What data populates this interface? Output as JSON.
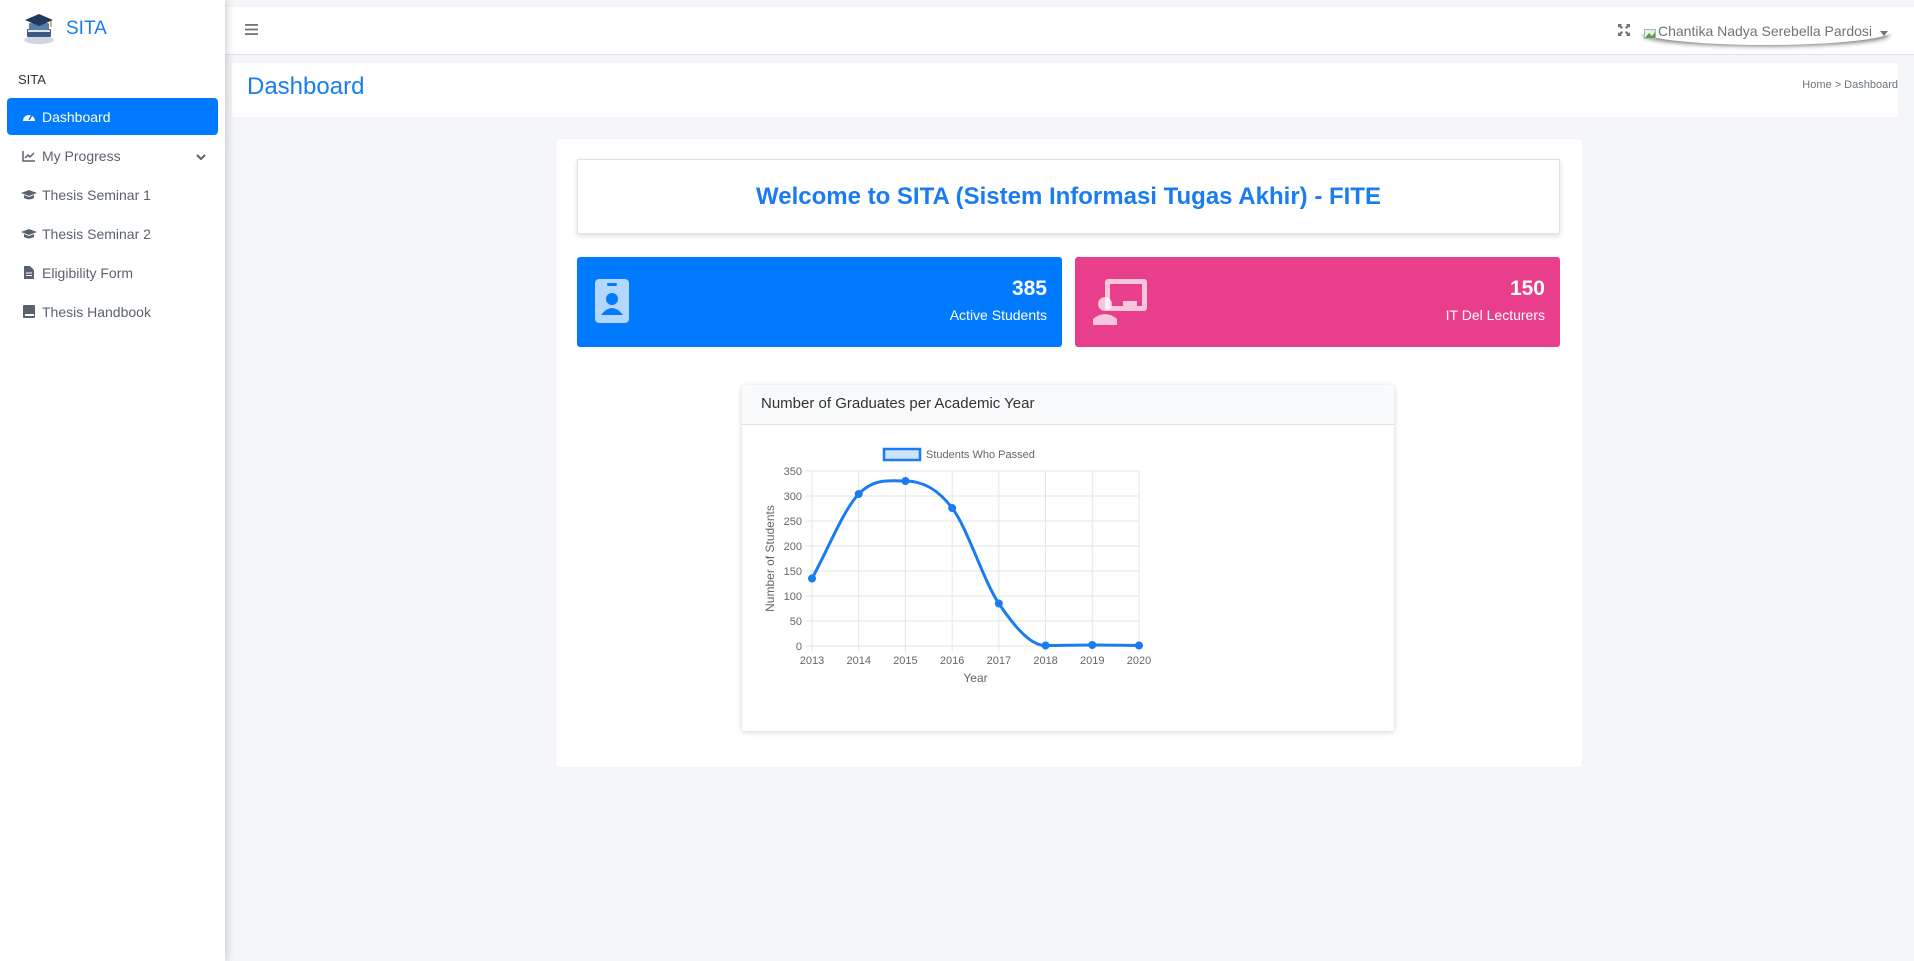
{
  "brand": {
    "name": "SITA"
  },
  "sidebar": {
    "section": "SITA",
    "items": [
      {
        "label": "Dashboard",
        "icon": "tachometer-icon",
        "active": true
      },
      {
        "label": "My Progress",
        "icon": "chart-line-icon",
        "has_children": true
      },
      {
        "label": "Thesis Seminar 1",
        "icon": "graduation-cap-icon"
      },
      {
        "label": "Thesis Seminar 2",
        "icon": "graduation-cap-icon"
      },
      {
        "label": "Eligibility Form",
        "icon": "file-icon"
      },
      {
        "label": "Thesis Handbook",
        "icon": "book-icon"
      }
    ]
  },
  "topbar": {
    "user_name": "Chantika Nadya Serebella Pardosi"
  },
  "header": {
    "title": "Dashboard",
    "breadcrumb": "Home > Dashboard"
  },
  "welcome": {
    "text": "Welcome to SITA (Sistem Informasi Tugas Akhir) - FITE"
  },
  "stats": [
    {
      "value": "385",
      "label": "Active Students",
      "color": "#007bff",
      "icon": "id-badge-icon"
    },
    {
      "value": "150",
      "label": "IT Del Lecturers",
      "color": "#e83e8c",
      "icon": "chalkboard-teacher-icon"
    }
  ],
  "chart_card": {
    "title": "Number of Graduates per Academic Year"
  },
  "colors": {
    "accent": "#007bff",
    "pink": "#e83e8c",
    "line": "#1a7cf0"
  },
  "chart_data": {
    "type": "line",
    "x": [
      "2013",
      "2014",
      "2015",
      "2016",
      "2017",
      "2018",
      "2019",
      "2020"
    ],
    "series": [
      {
        "name": "Students Who Passed",
        "values": [
          135,
          304,
          330,
          276,
          85,
          1,
          2,
          1
        ]
      }
    ],
    "xlabel": "Year",
    "ylabel": "Number of Students",
    "ylim": [
      0,
      350
    ],
    "yticks": [
      "0",
      "50",
      "100",
      "150",
      "200",
      "250",
      "300",
      "350"
    ],
    "grid": true,
    "legend": "top",
    "smooth": true
  }
}
